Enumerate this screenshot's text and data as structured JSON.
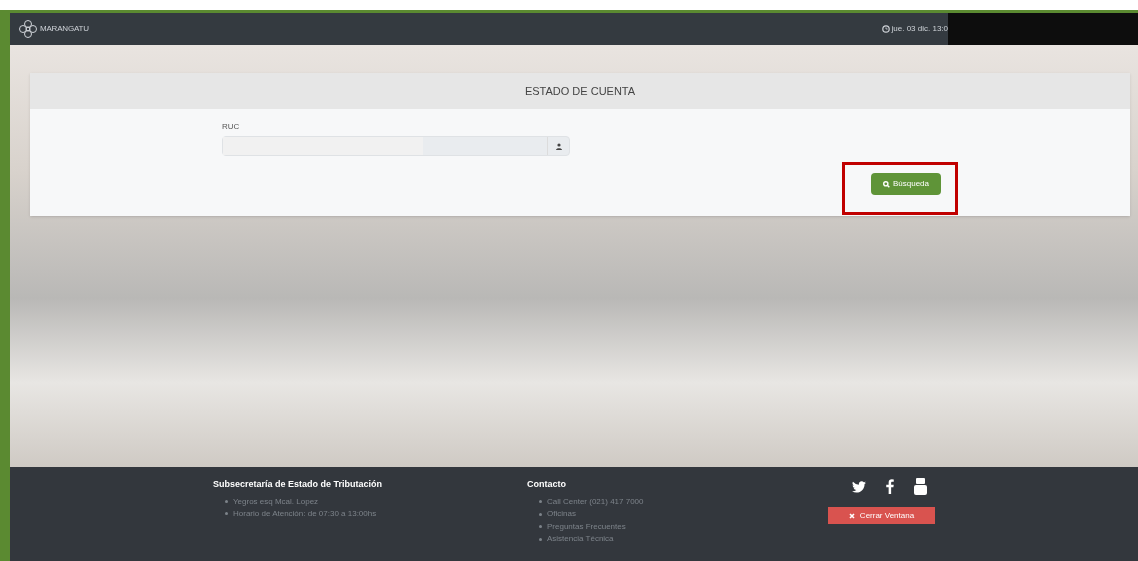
{
  "topbar": {
    "brand": "MARANGATU",
    "datetime": "jue. 03 dic. 13:0"
  },
  "card": {
    "title": "ESTADO DE CUENTA",
    "field": {
      "label": "RUC"
    },
    "search_button": "Búsqueda"
  },
  "footer": {
    "org": {
      "title": "Subsecretaría de Estado de Tributación",
      "items": [
        "Yegros esq Mcal. Lopez",
        "Horario de Atención: de 07:30 a 13:00hs"
      ]
    },
    "contact": {
      "title": "Contacto",
      "items": [
        "Call Center (021) 417 7000",
        "Oficinas",
        "Preguntas Frecuentes",
        "Asistencia Técnica"
      ]
    },
    "close_button": "Cerrar Ventana"
  }
}
